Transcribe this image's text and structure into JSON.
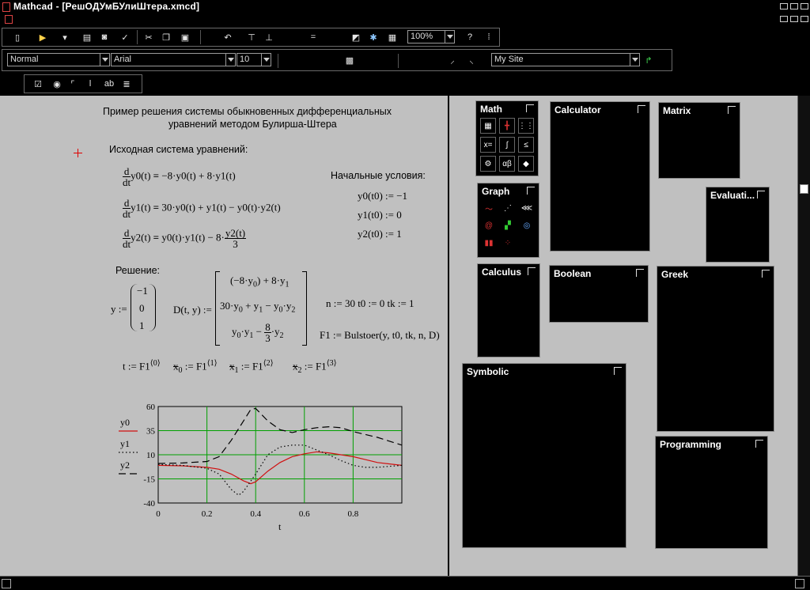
{
  "window": {
    "title": "Mathcad - [РешОДУмБУлиШтера.xmcd]"
  },
  "toolbar_format": {
    "style_value": "Normal",
    "font_value": "Arial",
    "size_value": "10",
    "site_value": "My Site"
  },
  "toolbar_standard": {
    "zoom_value": "100%"
  },
  "worksheet": {
    "heading_line1": "Пример решения системы обыкновенных дифференциальных",
    "heading_line2": "уравнений методом Булирша-Штера",
    "system_label": "Исходная система уравнений:",
    "initial_label": "Начальные условия:",
    "solution_label": "Решение:",
    "eq1_rhs": "−8·y0(t) + 8·y1(t)",
    "eq2_rhs": "30·y0(t) + y1(t) − y0(t)·y2(t)",
    "ic1": "y0(t0) := −1",
    "ic2": "y1(t0) := 0",
    "ic3": "y2(t0) := 1",
    "params": "n := 30     t0 := 0     tk := 1",
    "solver_call": "F1 := Bulstoer(y, t0, tk, n, D)",
    "y_vector": [
      "−1",
      "0",
      "1"
    ]
  },
  "chart_data": {
    "type": "line",
    "xlabel": "t",
    "ylabel": "",
    "xlim": [
      0,
      1
    ],
    "ylim": [
      -40,
      60
    ],
    "x_ticks": [
      "0",
      "0.2",
      "0.4",
      "0.6",
      "0.8"
    ],
    "y_ticks": [
      "60",
      "35",
      "10",
      "-15",
      "-40"
    ],
    "legend": [
      "y0",
      "y1",
      "y2"
    ],
    "series": [
      {
        "name": "y0",
        "color": "#d01010",
        "dash": "solid",
        "x": [
          0,
          0.1,
          0.2,
          0.25,
          0.3,
          0.35,
          0.38,
          0.4,
          0.45,
          0.5,
          0.55,
          0.6,
          0.65,
          0.7,
          0.75,
          0.8,
          0.85,
          0.9,
          0.95,
          1.0
        ],
        "y": [
          -1,
          -1.5,
          -3,
          -5,
          -10,
          -17,
          -20,
          -18,
          -7,
          2,
          8,
          11,
          13,
          12,
          10,
          8,
          5,
          2,
          0.5,
          -1
        ]
      },
      {
        "name": "y1",
        "color": "#000000",
        "dash": "dotted",
        "x": [
          0,
          0.1,
          0.2,
          0.25,
          0.3,
          0.33,
          0.35,
          0.4,
          0.45,
          0.5,
          0.55,
          0.6,
          0.65,
          0.7,
          0.75,
          0.8,
          0.85,
          0.9,
          0.95,
          1.0
        ],
        "y": [
          0,
          -1,
          -4,
          -10,
          -26,
          -32,
          -28,
          -10,
          10,
          18,
          20,
          20,
          15,
          10,
          4,
          -1,
          -3,
          -3,
          -2,
          -1
        ]
      },
      {
        "name": "y2",
        "color": "#000000",
        "dash": "dashed",
        "x": [
          0,
          0.1,
          0.2,
          0.25,
          0.3,
          0.35,
          0.38,
          0.4,
          0.45,
          0.5,
          0.55,
          0.6,
          0.65,
          0.7,
          0.75,
          0.8,
          0.85,
          0.9,
          0.95,
          1.0
        ],
        "y": [
          1,
          1.5,
          3,
          8,
          25,
          45,
          57,
          58,
          45,
          36,
          33,
          36,
          38,
          39,
          38,
          34,
          31,
          28,
          24,
          20
        ]
      }
    ]
  },
  "palettes": [
    {
      "id": "math",
      "title": "Math"
    },
    {
      "id": "calculator",
      "title": "Calculator"
    },
    {
      "id": "matrix",
      "title": "Matrix"
    },
    {
      "id": "evaluation",
      "title": "Evaluati..."
    },
    {
      "id": "graph",
      "title": "Graph"
    },
    {
      "id": "calculus",
      "title": "Calculus"
    },
    {
      "id": "boolean",
      "title": "Boolean"
    },
    {
      "id": "greek",
      "title": "Greek"
    },
    {
      "id": "symbolic",
      "title": "Symbolic"
    },
    {
      "id": "programming",
      "title": "Programming"
    }
  ],
  "colors": {
    "worksheet_bg": "#c0c0c0",
    "plot_grid": "#00a000",
    "y0_line": "#d01010",
    "cursor_cross": "#e00000"
  }
}
